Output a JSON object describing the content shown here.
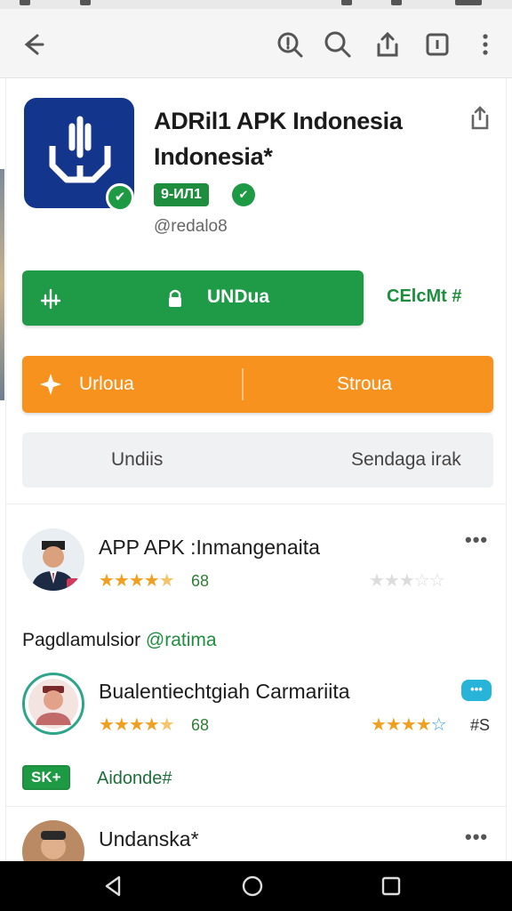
{
  "toolbar": {
    "back_icon": "arrow-left-icon",
    "actions": [
      "zoom-icon",
      "search-icon",
      "share-icon",
      "tabs-icon",
      "more-vert-icon"
    ]
  },
  "app": {
    "title": "ADRil1 APK Indonesia Indonesia*",
    "tag_badge": "9-ИЛ1",
    "developer": "@redalo8"
  },
  "actions": {
    "install_label": "UNDua",
    "side_link": "CElcMt #",
    "orange_left": "Urloua",
    "orange_right": "Stroua",
    "gray_left": "Undiis",
    "gray_right": "Sendaga irak"
  },
  "reviews": [
    {
      "name": "APP APK :Inmangenaita",
      "rating_text": "68",
      "rating": 4.5
    },
    {
      "name": "Bualentiechtgiah Carmariita",
      "rating_text": "68",
      "right_rating_text": "#S",
      "rating": 4.5,
      "chat_badge": "•••"
    },
    {
      "name": "Undanska*"
    }
  ],
  "sections": {
    "label_main": "Pagdlamulsior",
    "label_highlight": "@ratima",
    "tag": "SK+",
    "tag_text": "Aidonde#"
  },
  "colors": {
    "accent_green": "#1f9a47",
    "accent_orange": "#f7921e",
    "app_icon_bg": "#13368c"
  }
}
